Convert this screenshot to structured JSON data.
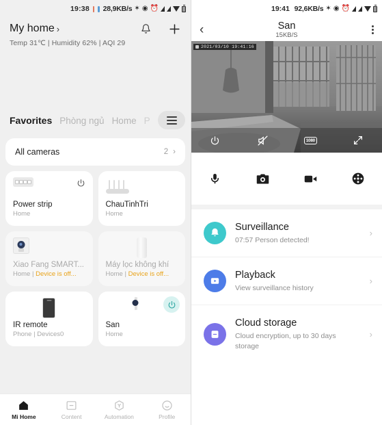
{
  "left": {
    "statusbar": {
      "time": "19:38",
      "network_speed": "28,9KB/s",
      "icons": [
        "bluetooth-icon",
        "vibrate-icon",
        "alarm-icon",
        "signal-icon",
        "signal-icon",
        "wifi-icon",
        "battery-icon"
      ]
    },
    "header": {
      "title": "My home",
      "chevron": "›",
      "subtitle": "Temp 31℃ | Humidity 62% | AQI 29",
      "bell_icon": "bell-icon",
      "add_icon": "plus-icon"
    },
    "tabs": [
      {
        "label": "Favorites",
        "active": true
      },
      {
        "label": "Phòng ngủ",
        "active": false
      },
      {
        "label": "Home",
        "active": false
      },
      {
        "label": "P",
        "active": false
      }
    ],
    "all_cameras": {
      "label": "All cameras",
      "count": "2",
      "chevron": "›"
    },
    "devices": [
      {
        "name": "Power strip",
        "sub": "Home",
        "sub_warn": "",
        "icon": "power-strip-icon",
        "power": "off",
        "dim": false
      },
      {
        "name": "ChauTinhTri",
        "sub": "Home",
        "sub_warn": "",
        "icon": "router-icon",
        "power": "none",
        "dim": false
      },
      {
        "name": "Xiao Fang SMART...",
        "sub": "Home | ",
        "sub_warn": "Device is off...",
        "icon": "camera-square-icon",
        "power": "none",
        "dim": true
      },
      {
        "name": "Máy lọc không khí",
        "sub": "Home | ",
        "sub_warn": "Device is off...",
        "icon": "air-purifier-icon",
        "power": "none",
        "dim": true
      },
      {
        "name": "IR remote",
        "sub": "Phone | Devices0",
        "sub_warn": "",
        "icon": "phone-icon",
        "power": "none",
        "dim": false
      },
      {
        "name": "San",
        "sub": "Home",
        "sub_warn": "",
        "icon": "camera-icon",
        "power": "on",
        "dim": false
      }
    ],
    "bottom_nav": [
      {
        "label": "Mi Home",
        "icon": "home-icon",
        "active": true
      },
      {
        "label": "Content",
        "icon": "content-icon",
        "active": false
      },
      {
        "label": "Automation",
        "icon": "automation-icon",
        "active": false
      },
      {
        "label": "Profile",
        "icon": "profile-icon",
        "active": false
      }
    ]
  },
  "right": {
    "statusbar": {
      "time": "19:41",
      "network_speed": "92,6KB/s"
    },
    "appbar": {
      "back_icon": "back-chevron-icon",
      "title": "San",
      "subtitle": "15KB/S",
      "more_icon": "overflow-menu-icon"
    },
    "video": {
      "timestamp": "2021/03/10  19:41:16",
      "controls": [
        {
          "name": "power-icon",
          "label": "Power"
        },
        {
          "name": "mute-icon",
          "label": "Mute"
        },
        {
          "name": "resolution-badge",
          "label": "1080"
        },
        {
          "name": "fullscreen-icon",
          "label": "Fullscreen"
        }
      ]
    },
    "actions": [
      {
        "name": "microphone-icon",
        "label": "Talk"
      },
      {
        "name": "snapshot-camera-icon",
        "label": "Snapshot"
      },
      {
        "name": "record-video-icon",
        "label": "Record"
      },
      {
        "name": "dpad-icon",
        "label": "Pan/Tilt"
      }
    ],
    "features": [
      {
        "title": "Surveillance",
        "desc": "07:57 Person detected!",
        "icon": "bell-icon",
        "color": "#3ec9cc",
        "chevron": "›"
      },
      {
        "title": "Playback",
        "desc": "View surveillance history",
        "icon": "play-icon",
        "color": "#4d7ce8",
        "chevron": "›"
      },
      {
        "title": "Cloud storage",
        "desc": "Cloud encryption, up to 30 days storage",
        "icon": "cloud-doc-icon",
        "color": "#7a72e8",
        "chevron": "›"
      }
    ]
  }
}
